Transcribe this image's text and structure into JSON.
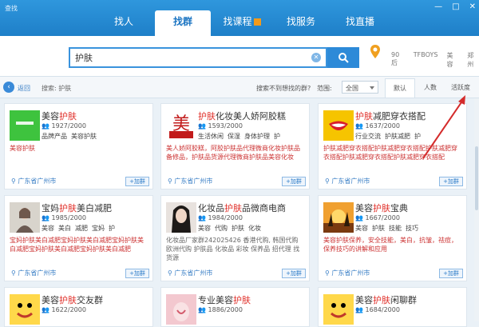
{
  "app": {
    "title": "查找"
  },
  "window_buttons": [
    "—",
    "□",
    "✕"
  ],
  "tabs": [
    {
      "label": "找人",
      "active": false
    },
    {
      "label": "找群",
      "active": true
    },
    {
      "label": "找课程",
      "active": false,
      "hot": true
    },
    {
      "label": "找服务",
      "active": false
    },
    {
      "label": "找直播",
      "active": false
    }
  ],
  "search": {
    "value": "护肤",
    "clear": "✕"
  },
  "hot_words": [
    "90后",
    "TFBOYS",
    "美容",
    "郑州"
  ],
  "filter": {
    "back_label": "返回",
    "breadcrumb": "搜索: 护肤",
    "not_fit": "搜索不到想找的群?",
    "range_label": "范围:",
    "range_value": "全国",
    "sort": [
      "默认",
      "人数",
      "活跃度"
    ]
  },
  "join_label": "+加群",
  "cards": [
    {
      "name_pre": "美容",
      "name_hl": "护肤",
      "name_post": "",
      "members": "1927/2000",
      "tags": [
        "品牌产品",
        "美容护肤"
      ],
      "desc": "美容护肤",
      "loc": "广东省广州市"
    },
    {
      "name_pre": "",
      "name_hl": "护肤",
      "name_post": "化妆美人娇阿胶糕",
      "members": "1593/2000",
      "tags": [
        "生活休闲",
        "保湿",
        "身体护理",
        "护"
      ],
      "desc": "美人娇阿胶糕，阿胶护肤品代理微商化妆护肤品备修品，护肤品货源代理微商护肤品美容化妆品。",
      "loc": "广东省广州市"
    },
    {
      "name_pre": "",
      "name_hl": "护肤",
      "name_post": "减肥穿衣搭配",
      "members": "1637/2000",
      "tags": [
        "行业交流",
        "护肤减肥",
        "护"
      ],
      "desc": "护肤减肥穿衣搭配护肤减肥穿衣搭配护肤减肥穿衣搭配护肤减肥穿衣搭配护肤减肥穿衣搭配",
      "loc": "广东省广州市"
    },
    {
      "name_pre": "宝妈",
      "name_hl": "护肤",
      "name_post": "美白减肥",
      "members": "1985/2000",
      "tags": [
        "美容",
        "美白",
        "减肥",
        "宝妈",
        "护"
      ],
      "desc": "宝妈护肤美白减肥宝妈护肤美白减肥宝妈护肤美白减肥宝妈护肤美白减肥宝妈护肤美白减肥",
      "loc": "广东省广州市"
    },
    {
      "name_pre": "化妆品",
      "name_hl": "护肤",
      "name_post": "品微商电商",
      "members": "1984/2000",
      "tags": [
        "美容",
        "代购",
        "护肤",
        "化妆"
      ],
      "desc": "化妆品厂家群242025426 香港代购, 韩国代购 欧洲代购 护肤品 化妆品 彩妆 保养品 招代理 找货源",
      "loc": "广东省广州市"
    },
    {
      "name_pre": "美容",
      "name_hl": "护肤",
      "name_post": "宝典",
      "members": "1667/2000",
      "tags": [
        "美容",
        "护肤",
        "技能",
        "技巧"
      ],
      "desc": "美容护肤保养，安全技能，美白，抗皱，祛痘，保养技巧的讲解和应用",
      "loc": "广东省广州市"
    },
    {
      "name_pre": "美容",
      "name_hl": "护肤",
      "name_post": "交友群",
      "members": "1622/2000",
      "tags": [],
      "desc": "",
      "loc": ""
    },
    {
      "name_pre": "专业美容",
      "name_hl": "护肤",
      "name_post": "",
      "members": "1886/2000",
      "tags": [],
      "desc": "",
      "loc": ""
    },
    {
      "name_pre": "美容",
      "name_hl": "护肤",
      "name_post": "闲聊群",
      "members": "1684/2000",
      "tags": [],
      "desc": "",
      "loc": ""
    }
  ],
  "colors": {
    "accent": "#1e7fc8",
    "highlight": "#e0302a",
    "annotation_arrow": "#d42b2b"
  }
}
